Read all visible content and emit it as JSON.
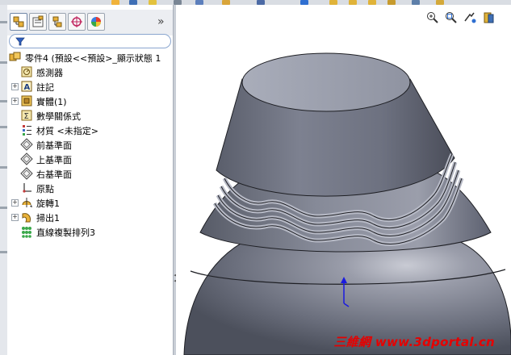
{
  "feature_manager": {
    "tabs": [
      {
        "name": "featuremanager-tab",
        "icon": "feature-tree-icon"
      },
      {
        "name": "propertymanager-tab",
        "icon": "property-icon"
      },
      {
        "name": "configurationmanager-tab",
        "icon": "configuration-icon"
      },
      {
        "name": "dimxpert-tab",
        "icon": "crosshair-icon"
      },
      {
        "name": "display-manager-tab",
        "icon": "appearance-icon"
      }
    ],
    "more_tabs_glyph": "»",
    "filter_placeholder": "",
    "tree": [
      {
        "label": "零件4 (預設<<預設>_顯示狀態 1",
        "icon": "part-icon",
        "expandable": false
      },
      {
        "label": "感測器",
        "icon": "sensor-icon",
        "expandable": false
      },
      {
        "label": "註記",
        "icon": "annotation-icon",
        "expandable": true
      },
      {
        "label": "實體(1)",
        "icon": "solid-bodies-icon",
        "expandable": true
      },
      {
        "label": "數學關係式",
        "icon": "equation-icon",
        "expandable": false
      },
      {
        "label": "材質 <未指定>",
        "icon": "material-icon",
        "expandable": false
      },
      {
        "label": "前基準面",
        "icon": "plane-icon",
        "expandable": false
      },
      {
        "label": "上基準面",
        "icon": "plane-icon",
        "expandable": false
      },
      {
        "label": "右基準面",
        "icon": "plane-icon",
        "expandable": false
      },
      {
        "label": "原點",
        "icon": "origin-icon",
        "expandable": false
      },
      {
        "label": "旋轉1",
        "icon": "revolve-icon",
        "expandable": true
      },
      {
        "label": "掃出1",
        "icon": "sweep-icon",
        "expandable": true
      },
      {
        "label": "直線複製排列3",
        "icon": "linear-pattern-icon",
        "expandable": false
      }
    ]
  },
  "view_toolbar": [
    {
      "name": "zoom-to-fit-icon"
    },
    {
      "name": "zoom-to-area-icon"
    },
    {
      "name": "previous-view-icon"
    },
    {
      "name": "section-view-icon"
    }
  ],
  "watermark": "三維網 www.3dportal.cn",
  "colors": {
    "model_body": "#7c808e",
    "model_shadow": "#4f535f",
    "watermark": "#e60000",
    "panel_bg": "#ffffff"
  }
}
